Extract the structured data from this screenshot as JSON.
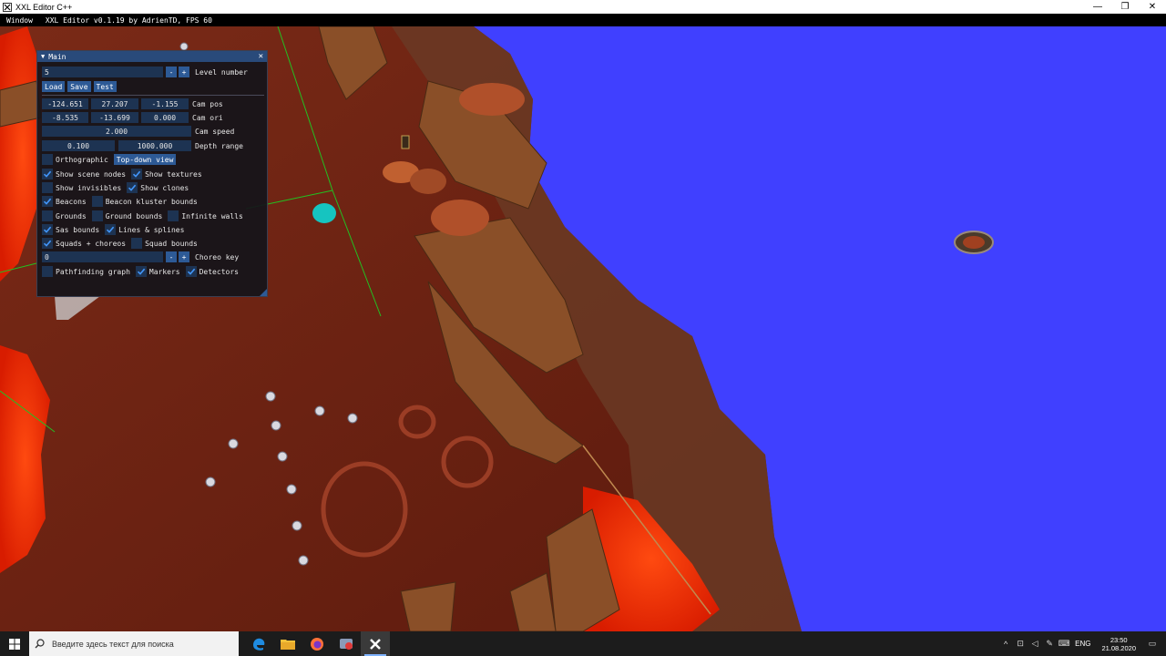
{
  "window": {
    "title": "XXL Editor C++",
    "minimize_glyph": "—",
    "maximize_glyph": "❐",
    "close_glyph": "✕"
  },
  "menubar": {
    "items": [
      "Window",
      "XXL Editor v0.1.19 by AdrienTD, FPS 60"
    ]
  },
  "main_panel": {
    "title": "Main",
    "collapse_glyph": "▼",
    "close_glyph": "✕",
    "level": {
      "value": "5",
      "minus": "-",
      "plus": "+",
      "label": "Level number"
    },
    "buttons": {
      "load": "Load",
      "save": "Save",
      "test": "Test"
    },
    "cam_pos": {
      "values": [
        "-124.651",
        "27.207",
        "-1.155"
      ],
      "label": "Cam pos"
    },
    "cam_ori": {
      "values": [
        "-8.535",
        "-13.699",
        "0.000"
      ],
      "label": "Cam ori"
    },
    "cam_speed": {
      "value": "2.000",
      "label": "Cam speed"
    },
    "depth_range": {
      "values": [
        "0.100",
        "1000.000"
      ],
      "label": "Depth range"
    },
    "orthographic": {
      "label": "Orthographic",
      "checked": false
    },
    "top_down_button": "Top-down view",
    "checkboxes": {
      "show_scene_nodes": {
        "label": "Show scene nodes",
        "checked": true
      },
      "show_textures": {
        "label": "Show textures",
        "checked": true
      },
      "show_invisibles": {
        "label": "Show invisibles",
        "checked": false
      },
      "show_clones": {
        "label": "Show clones",
        "checked": true
      },
      "beacons": {
        "label": "Beacons",
        "checked": true
      },
      "beacon_kluster_bounds": {
        "label": "Beacon kluster bounds",
        "checked": false
      },
      "grounds": {
        "label": "Grounds",
        "checked": false
      },
      "ground_bounds": {
        "label": "Ground bounds",
        "checked": false
      },
      "infinite_walls": {
        "label": "Infinite walls",
        "checked": false
      },
      "sas_bounds": {
        "label": "Sas bounds",
        "checked": true
      },
      "lines_splines": {
        "label": "Lines & splines",
        "checked": true
      },
      "squads_choreos": {
        "label": "Squads + choreos",
        "checked": true
      },
      "squad_bounds": {
        "label": "Squad bounds",
        "checked": false
      },
      "pathfinding_graph": {
        "label": "Pathfinding graph",
        "checked": false
      },
      "markers": {
        "label": "Markers",
        "checked": true
      },
      "detectors": {
        "label": "Detectors",
        "checked": true
      }
    },
    "choreo": {
      "value": "0",
      "minus": "-",
      "plus": "+",
      "label": "Choreo key"
    }
  },
  "colors": {
    "sky": "#4040ff",
    "ground": "#6e1f12",
    "lava": "#ff2a00",
    "wood": "#8a4f28",
    "panel_bg": "#14141a",
    "frame_bg": "#1d3352",
    "button": "#2d5a96",
    "title_active": "#294a7a",
    "check": "#4296fa",
    "taskbar": "#1c1c1c"
  },
  "taskbar": {
    "search_placeholder": "Введите здесь текст для поиска",
    "apps": [
      "edge-icon",
      "file-explorer-icon",
      "firefox-icon",
      "video-app-icon",
      "xxl-editor-icon"
    ],
    "language": "ENG",
    "time": "23:50",
    "date": "21.08.2020"
  }
}
